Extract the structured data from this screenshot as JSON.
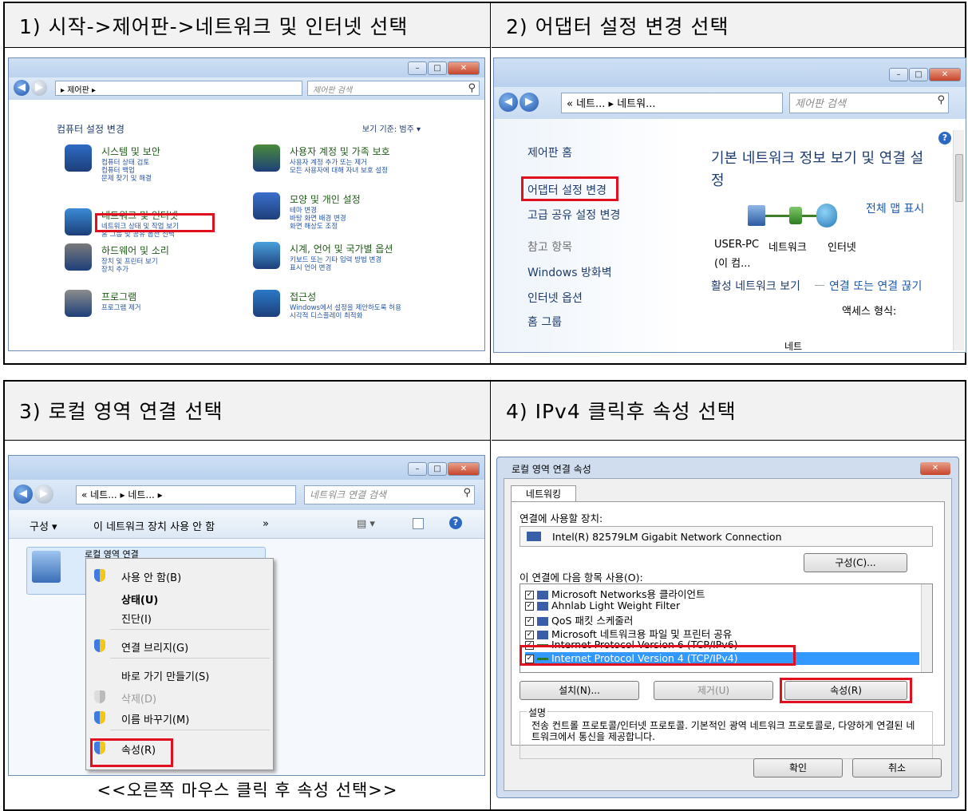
{
  "headers": {
    "h1": "1) 시작->제어판->네트워크 및 인터넷 선택",
    "h2": "2) 어댑터 설정 변경 선택",
    "h3": "3) 로컬 영역 연결 선택",
    "h4": "4) IPv4 클릭후 속성 선택"
  },
  "p1": {
    "address": "▸ 제어판 ▸",
    "search_placeholder": "제어판 검색",
    "title": "컴퓨터 설정 변경",
    "view_by": "보기 기준:  범주 ▾",
    "categories": [
      {
        "head": "시스템 및 보안",
        "links": [
          "컴퓨터 상태 검토",
          "컴퓨터 백업",
          "문제 찾기 및 해결"
        ],
        "color": "#2e6bc4"
      },
      {
        "head": "네트워크 및 인터넷",
        "links": [
          "네트워크 상태 및 작업 보기",
          "홈 그룹 및 공유 옵션 선택"
        ],
        "color": "#3a8bd6"
      },
      {
        "head": "하드웨어 및 소리",
        "links": [
          "장치 및 프린터 보기",
          "장치 추가"
        ],
        "color": "#7a7a7a"
      },
      {
        "head": "프로그램",
        "links": [
          "프로그램 제거"
        ],
        "color": "#8c8c8c"
      },
      {
        "head": "사용자 계정 및 가족 보호",
        "links": [
          "사용자 계정 추가 또는 제거",
          "모든 사용자에 대해 자녀 보호 설정"
        ],
        "color": "#4a8a3a"
      },
      {
        "head": "모양 및 개인 설정",
        "links": [
          "테마 변경",
          "바탕 화면 배경 변경",
          "화면 해상도 조정"
        ],
        "color": "#3b6fcc"
      },
      {
        "head": "시계, 언어 및 국가별 옵션",
        "links": [
          "키보드 또는 기타 입력 방법 변경",
          "표시 언어 변경"
        ],
        "color": "#4aa0dc"
      },
      {
        "head": "접근성",
        "links": [
          "Windows에서 설정을 제안하도록 허용",
          "시각적 디스플레이 최적화"
        ],
        "color": "#2a78c8"
      }
    ]
  },
  "p2": {
    "address": "« 네트... ▸ 네트워...",
    "search_placeholder": "제어판 검색",
    "home": "제어판 홈",
    "adapter": "어댑터 설정 변경",
    "sharing": "고급 공유 설정 변경",
    "see_also": "참고 항목",
    "firewall": "Windows 방화벽",
    "inet_opts": "인터넷 옵션",
    "homegroup": "홈 그룹",
    "heading": "기본 네트워크 정보 보기 및 연결 설정",
    "full_map": "전체 맵 표시",
    "pc": "USER-PC",
    "pc_sub": "(이 컴...",
    "network": "네트워크",
    "internet": "인터넷",
    "active": "활성 네트워크 보기",
    "connect": "연결 또는 연결 끊기",
    "access": "액세스 형식:",
    "net_label": "네트"
  },
  "p3": {
    "address": "« 네트... ▸ 네트... ▸",
    "search_placeholder": "네트워크 연결 검색",
    "organize": "구성 ▾",
    "disable_dev": "이 네트워크 장치 사용 안 함",
    "more": "»",
    "conn_name": "로컬 영역 연결",
    "menu": [
      {
        "label": "사용 안 함(B)",
        "shield": true,
        "bold": false,
        "gray": false
      },
      {
        "label": "상태(U)",
        "shield": false,
        "bold": true,
        "gray": false
      },
      {
        "label": "진단(I)",
        "shield": false,
        "bold": false,
        "gray": false
      },
      {
        "label": "연결 브리지(G)",
        "shield": true,
        "bold": false,
        "gray": false
      },
      {
        "label": "바로 가기 만들기(S)",
        "shield": false,
        "bold": false,
        "gray": false
      },
      {
        "label": "삭제(D)",
        "shield": true,
        "bold": false,
        "gray": true
      },
      {
        "label": "이름 바꾸기(M)",
        "shield": true,
        "bold": false,
        "gray": false
      },
      {
        "label": "속성(R)",
        "shield": true,
        "bold": false,
        "gray": false
      }
    ],
    "caption": "<<오른쪽 마우스 클릭 후 속성 선택>>"
  },
  "p4": {
    "title": "로컬 영역 연결 속성",
    "tab": "네트워킹",
    "connect_using": "연결에 사용할 장치:",
    "adapter": "Intel(R) 82579LM Gigabit Network Connection",
    "configure": "구성(C)...",
    "items_label": "이 연결에 다음 항목 사용(O):",
    "items": [
      "Microsoft Networks용 클라이언트",
      "Ahnlab Light Weight Filter",
      "QoS 패킷 스케줄러",
      "Microsoft 네트워크용 파일 및 프린터 공유",
      "Internet Protocol Version 6 (TCP/IPv6)",
      "Internet Protocol Version 4 (TCP/IPv4)"
    ],
    "install": "설치(N)...",
    "uninstall": "제거(U)",
    "properties": "속성(R)",
    "desc_title": "설명",
    "desc": "전송 컨트롤 프로토콜/인터넷 프로토콜. 기본적인 광역 네트워크 프로토콜로, 다양하게 연결된 네트워크에서 통신을 제공합니다.",
    "ok": "확인",
    "cancel": "취소"
  }
}
